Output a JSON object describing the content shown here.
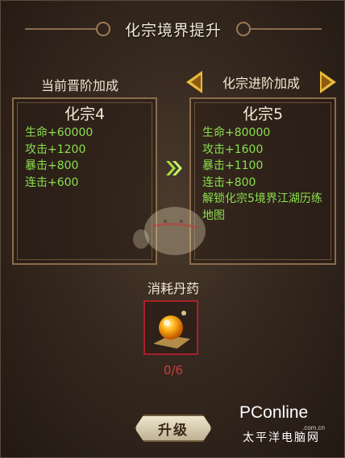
{
  "title": "化宗境界提升",
  "current": {
    "header": "当前晋阶加成",
    "realm": "化宗4",
    "stats": [
      "生命+60000",
      "攻击+1200",
      "暴击+800",
      "连击+600"
    ]
  },
  "next": {
    "header": "化宗进阶加成",
    "realm": "化宗5",
    "stats": [
      "生命+80000",
      "攻击+1600",
      "暴击+1100",
      "连击+800",
      "解锁化宗5境界江湖历练地图"
    ]
  },
  "consume": {
    "label": "消耗丹药",
    "item_icon": "golden-pill-icon",
    "count": "0/6"
  },
  "upgrade_button": "升级",
  "watermark": {
    "brand": "PConline",
    "site": ".com.cn",
    "cn": "太平洋电脑网"
  },
  "colors": {
    "stat_green": "#8be04e",
    "count_red": "#d33b3b",
    "arrow_gold": "#e9b93b",
    "frame_brown": "#8a6d4c"
  }
}
